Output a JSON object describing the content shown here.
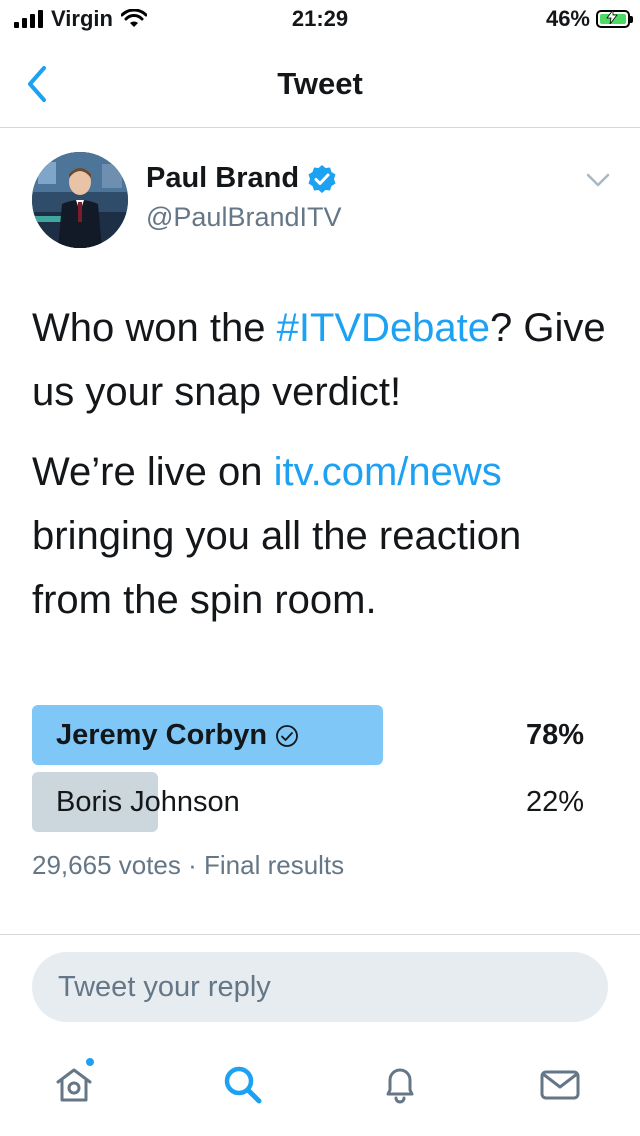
{
  "status_bar": {
    "carrier": "Virgin",
    "time": "21:29",
    "battery_percent": "46%",
    "battery_level": 0.46
  },
  "nav": {
    "title": "Tweet",
    "back_icon": "chevron-left-icon"
  },
  "tweet": {
    "author_name": "Paul Brand",
    "author_handle": "@PaulBrandITV",
    "verified": true,
    "text_line1_a": "Who won the ",
    "hashtag": "#ITVDebate",
    "text_line1_b": "? Give us your snap verdict!",
    "text_para2_a": "We’re live on ",
    "link": "itv.com/news",
    "text_para2_b": " bringing you all the reaction from the spin room."
  },
  "poll": {
    "options": [
      {
        "label": "Jeremy Corbyn",
        "percent_text": "78%",
        "percent": 78,
        "winner": true
      },
      {
        "label": "Boris Johnson",
        "percent_text": "22%",
        "percent": 22,
        "winner": false
      }
    ],
    "meta": "29,665 votes · Final results"
  },
  "reply": {
    "placeholder": "Tweet your reply"
  },
  "tabbar": {
    "items": [
      "home-icon",
      "search-icon",
      "notifications-icon",
      "messages-icon"
    ]
  },
  "colors": {
    "accent": "#1da1f2",
    "winner_bar": "#7fc7f7",
    "loser_bar": "#ccd6dd",
    "secondary_text": "#657786"
  }
}
